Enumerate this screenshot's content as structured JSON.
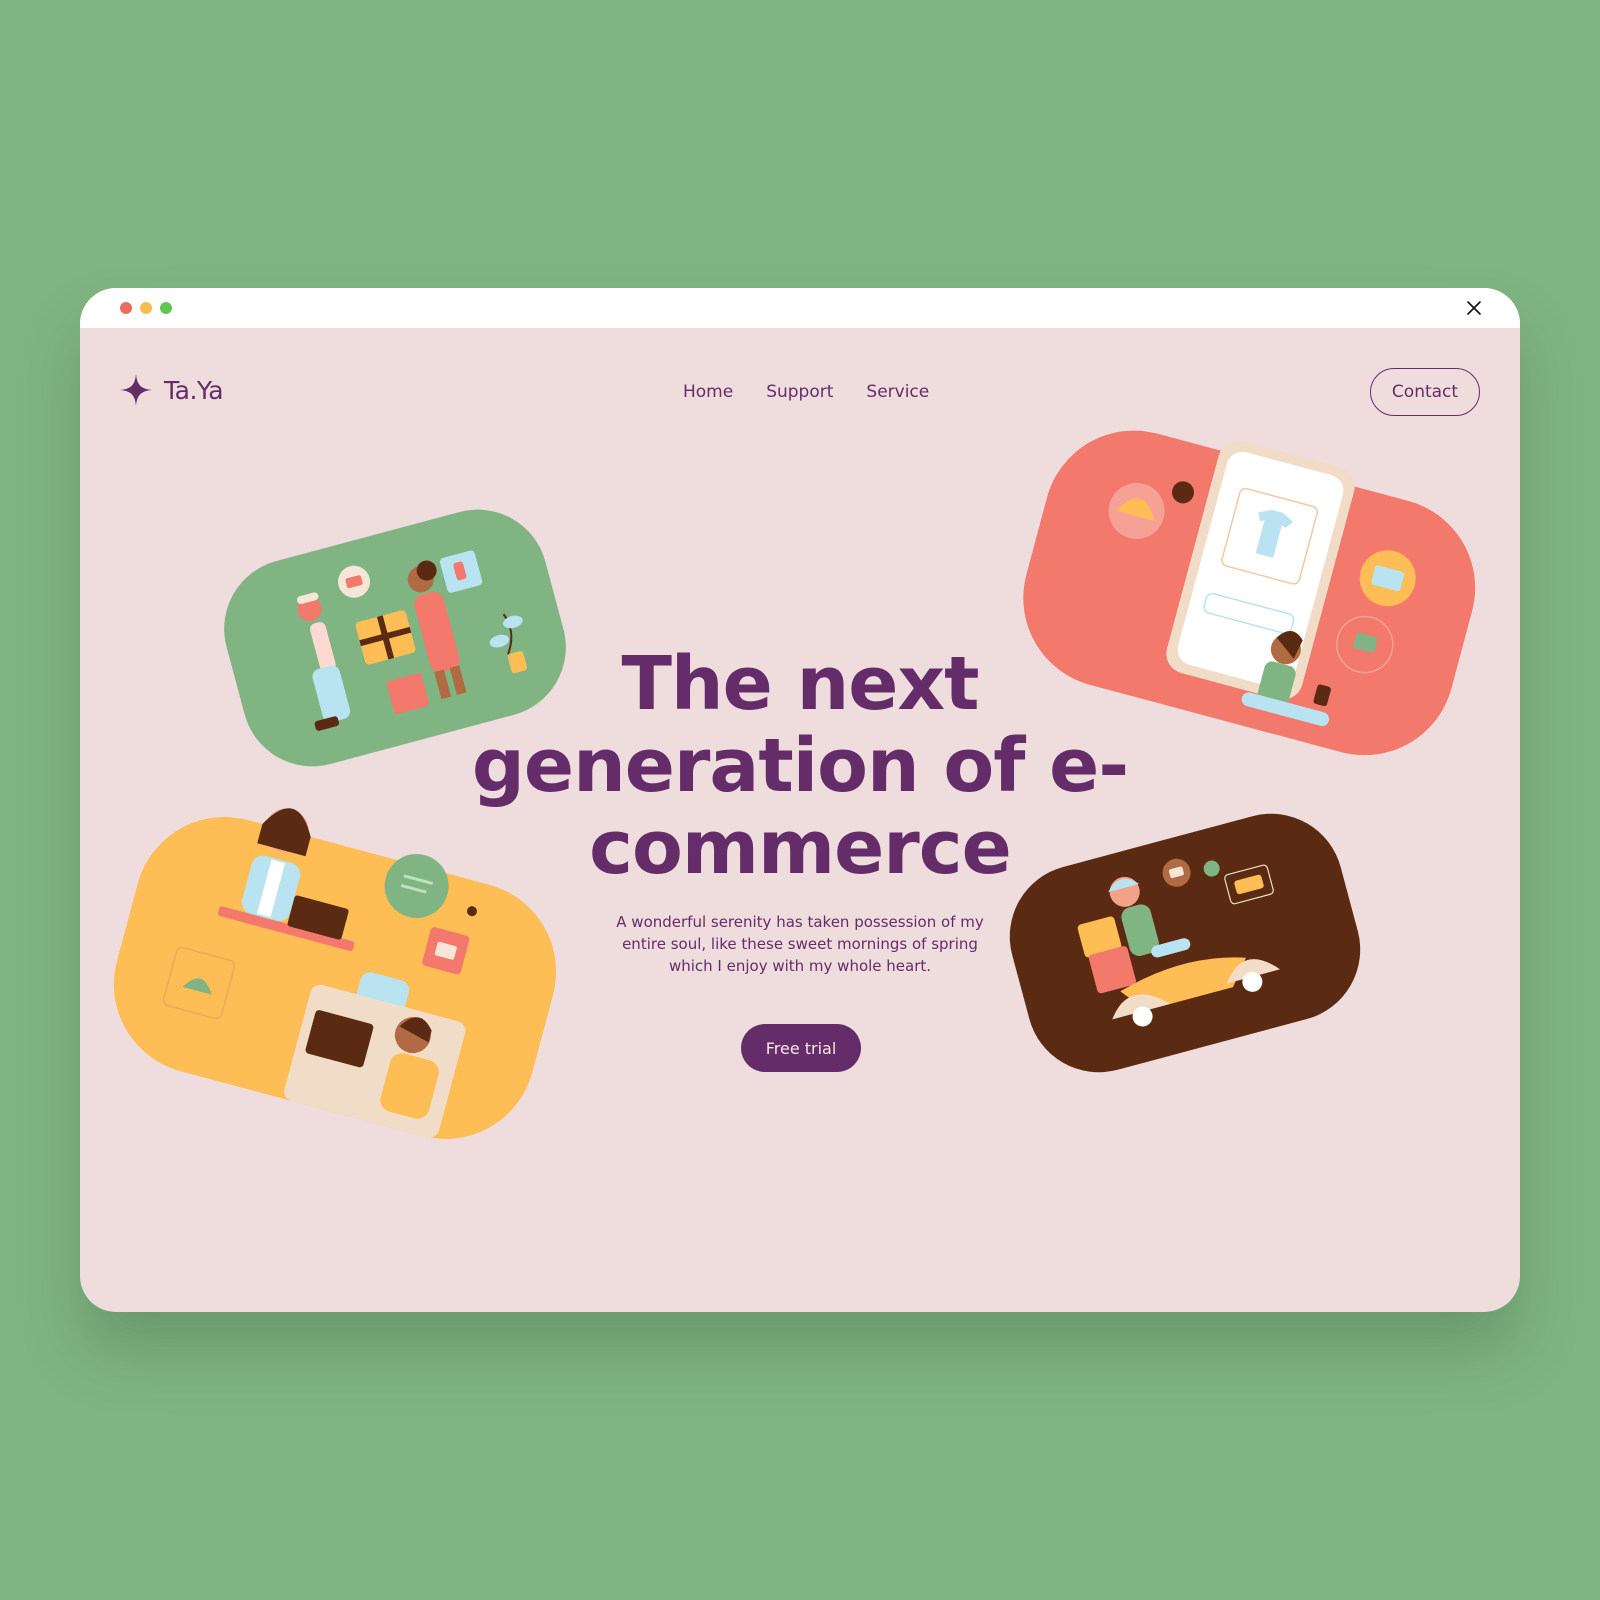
{
  "window": {
    "controls": [
      "close-dot",
      "minimize-dot",
      "maximize-dot"
    ],
    "close_icon": "close-icon"
  },
  "header": {
    "logo_text": "Ta.Ya",
    "logo_icon": "sparkle-star-icon",
    "nav": [
      {
        "label": "Home"
      },
      {
        "label": "Support"
      },
      {
        "label": "Service"
      }
    ],
    "contact_label": "Contact"
  },
  "hero": {
    "title_line1": "The next",
    "title_line2": "generation of e-",
    "title_line3": "commerce",
    "subtitle": "A wonderful serenity has taken possession of my entire soul, like these sweet mornings of spring which I enjoy with my whole heart.",
    "cta_label": "Free trial"
  },
  "illustrations": [
    {
      "name": "gift-exchange-illustration",
      "bg": "#81b483"
    },
    {
      "name": "mobile-shopping-illustration",
      "bg": "#f2796b"
    },
    {
      "name": "online-chat-illustration",
      "bg": "#ffbd55"
    },
    {
      "name": "scooter-delivery-illustration",
      "bg": "#5b2a12"
    }
  ],
  "colors": {
    "page_bg": "#81b483",
    "window_bg": "#efdcdd",
    "brand": "#652c6a",
    "green": "#81b483",
    "coral": "#f2796b",
    "yellow": "#ffbd55",
    "brown": "#5b2a12"
  }
}
